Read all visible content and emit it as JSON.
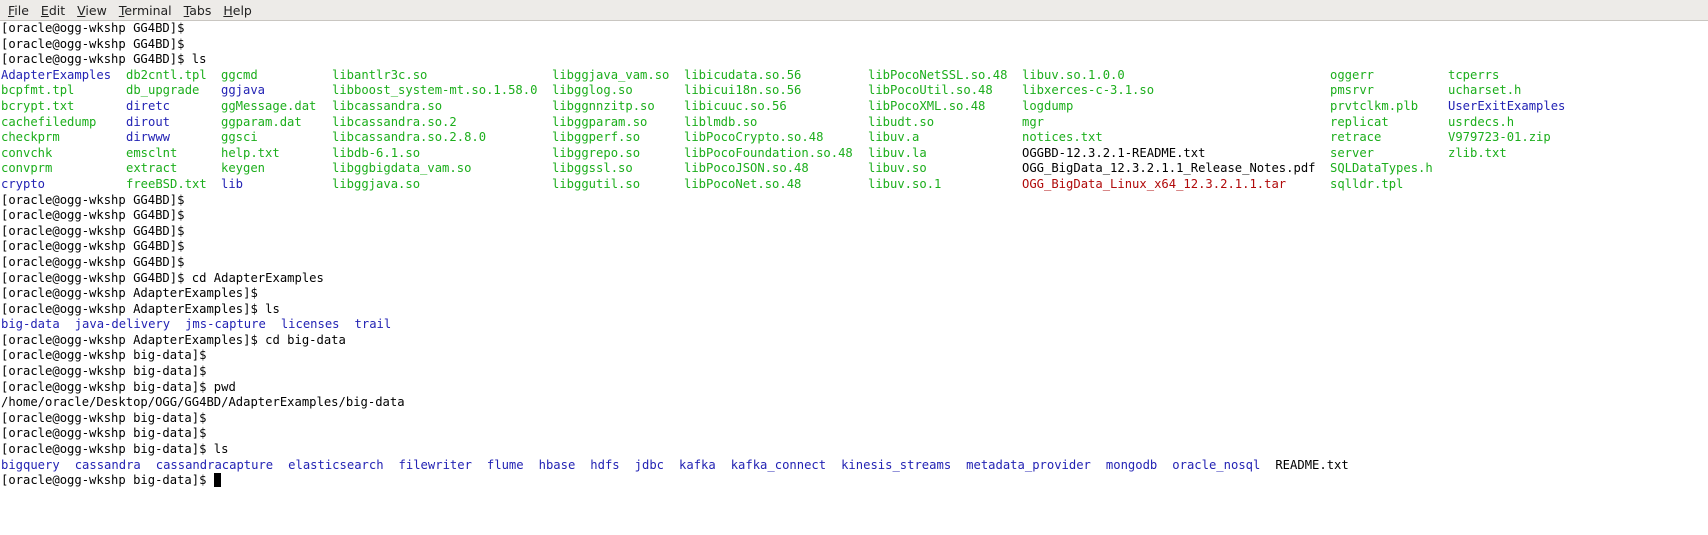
{
  "menu": [
    "File",
    "Edit",
    "View",
    "Terminal",
    "Tabs",
    "Help"
  ],
  "menu_mnemonic_index": [
    0,
    0,
    0,
    0,
    2,
    0
  ],
  "colors": {
    "exec": "#1cae1c",
    "dir": "#2323b4",
    "archive": "#b00a0a",
    "plain": "#000000"
  },
  "lines": [
    {
      "type": "text",
      "text": "[oracle@ogg-wkshp GG4BD]$"
    },
    {
      "type": "text",
      "text": "[oracle@ogg-wkshp GG4BD]$"
    },
    {
      "type": "text",
      "text": "[oracle@ogg-wkshp GG4BD]$ ls"
    },
    {
      "type": "grid",
      "cells": [
        [
          "AdapterExamples",
          "blue"
        ],
        [
          "db2cntl.tpl",
          "green"
        ],
        [
          "ggcmd",
          "green"
        ],
        [
          "libantlr3c.so",
          "green"
        ],
        [
          "libggjava_vam.so",
          "green"
        ],
        [
          "libicudata.so.56",
          "green"
        ],
        [
          "libPocoNetSSL.so.48",
          "green"
        ],
        [
          "libuv.so.1.0.0",
          "green"
        ],
        [
          "oggerr",
          "green"
        ],
        [
          "tcperrs",
          "green"
        ]
      ]
    },
    {
      "type": "grid",
      "cells": [
        [
          "bcpfmt.tpl",
          "green"
        ],
        [
          "db_upgrade",
          "green"
        ],
        [
          "ggjava",
          "blue"
        ],
        [
          "libboost_system-mt.so.1.58.0",
          "green"
        ],
        [
          "libgglog.so",
          "green"
        ],
        [
          "libicui18n.so.56",
          "green"
        ],
        [
          "libPocoUtil.so.48",
          "green"
        ],
        [
          "libxerces-c-3.1.so",
          "green"
        ],
        [
          "pmsrvr",
          "green"
        ],
        [
          "ucharset.h",
          "green"
        ]
      ]
    },
    {
      "type": "grid",
      "cells": [
        [
          "bcrypt.txt",
          "green"
        ],
        [
          "diretc",
          "blue"
        ],
        [
          "ggMessage.dat",
          "green"
        ],
        [
          "libcassandra.so",
          "green"
        ],
        [
          "libggnnzitp.so",
          "green"
        ],
        [
          "libicuuc.so.56",
          "green"
        ],
        [
          "libPocoXML.so.48",
          "green"
        ],
        [
          "logdump",
          "green"
        ],
        [
          "prvtclkm.plb",
          "green"
        ],
        [
          "UserExitExamples",
          "blue"
        ]
      ]
    },
    {
      "type": "grid",
      "cells": [
        [
          "cachefiledump",
          "green"
        ],
        [
          "dirout",
          "blue"
        ],
        [
          "ggparam.dat",
          "green"
        ],
        [
          "libcassandra.so.2",
          "green"
        ],
        [
          "libggparam.so",
          "green"
        ],
        [
          "liblmdb.so",
          "green"
        ],
        [
          "libudt.so",
          "green"
        ],
        [
          "mgr",
          "green"
        ],
        [
          "replicat",
          "green"
        ],
        [
          "usrdecs.h",
          "green"
        ]
      ]
    },
    {
      "type": "grid",
      "cells": [
        [
          "checkprm",
          "green"
        ],
        [
          "dirwww",
          "blue"
        ],
        [
          "ggsci",
          "green"
        ],
        [
          "libcassandra.so.2.8.0",
          "green"
        ],
        [
          "libggperf.so",
          "green"
        ],
        [
          "libPocoCrypto.so.48",
          "green"
        ],
        [
          "libuv.a",
          "green"
        ],
        [
          "notices.txt",
          "green"
        ],
        [
          "retrace",
          "green"
        ],
        [
          "V979723-01.zip",
          "green"
        ]
      ]
    },
    {
      "type": "grid",
      "cells": [
        [
          "convchk",
          "green"
        ],
        [
          "emsclnt",
          "green"
        ],
        [
          "help.txt",
          "green"
        ],
        [
          "libdb-6.1.so",
          "green"
        ],
        [
          "libggrepo.so",
          "green"
        ],
        [
          "libPocoFoundation.so.48",
          "green"
        ],
        [
          "libuv.la",
          "green"
        ],
        [
          "OGGBD-12.3.2.1-README.txt",
          "black"
        ],
        [
          "server",
          "green"
        ],
        [
          "zlib.txt",
          "green"
        ]
      ]
    },
    {
      "type": "grid",
      "cells": [
        [
          "convprm",
          "green"
        ],
        [
          "extract",
          "green"
        ],
        [
          "keygen",
          "green"
        ],
        [
          "libggbigdata_vam.so",
          "green"
        ],
        [
          "libggssl.so",
          "green"
        ],
        [
          "libPocoJSON.so.48",
          "green"
        ],
        [
          "libuv.so",
          "green"
        ],
        [
          "OGG_BigData_12.3.2.1.1_Release_Notes.pdf",
          "black"
        ],
        [
          "SQLDataTypes.h",
          "green"
        ],
        [
          "",
          ""
        ]
      ]
    },
    {
      "type": "grid",
      "cells": [
        [
          "crypto",
          "blue"
        ],
        [
          "freeBSD.txt",
          "green"
        ],
        [
          "lib",
          "blue"
        ],
        [
          "libggjava.so",
          "green"
        ],
        [
          "libggutil.so",
          "green"
        ],
        [
          "libPocoNet.so.48",
          "green"
        ],
        [
          "libuv.so.1",
          "green"
        ],
        [
          "OGG_BigData_Linux_x64_12.3.2.1.1.tar",
          "red"
        ],
        [
          "sqlldr.tpl",
          "green"
        ],
        [
          "",
          ""
        ]
      ]
    },
    {
      "type": "text",
      "text": "[oracle@ogg-wkshp GG4BD]$"
    },
    {
      "type": "text",
      "text": "[oracle@ogg-wkshp GG4BD]$"
    },
    {
      "type": "text",
      "text": "[oracle@ogg-wkshp GG4BD]$"
    },
    {
      "type": "text",
      "text": "[oracle@ogg-wkshp GG4BD]$"
    },
    {
      "type": "text",
      "text": "[oracle@ogg-wkshp GG4BD]$"
    },
    {
      "type": "text",
      "text": "[oracle@ogg-wkshp GG4BD]$ cd AdapterExamples"
    },
    {
      "type": "text",
      "text": "[oracle@ogg-wkshp AdapterExamples]$"
    },
    {
      "type": "text",
      "text": "[oracle@ogg-wkshp AdapterExamples]$ ls"
    },
    {
      "type": "inline",
      "cells": [
        [
          "big-data",
          "blue"
        ],
        [
          "java-delivery",
          "blue"
        ],
        [
          "jms-capture",
          "blue"
        ],
        [
          "licenses",
          "blue"
        ],
        [
          "trail",
          "blue"
        ]
      ]
    },
    {
      "type": "text",
      "text": "[oracle@ogg-wkshp AdapterExamples]$ cd big-data"
    },
    {
      "type": "text",
      "text": "[oracle@ogg-wkshp big-data]$"
    },
    {
      "type": "text",
      "text": "[oracle@ogg-wkshp big-data]$"
    },
    {
      "type": "text",
      "text": "[oracle@ogg-wkshp big-data]$ pwd"
    },
    {
      "type": "text",
      "text": "/home/oracle/Desktop/OGG/GG4BD/AdapterExamples/big-data"
    },
    {
      "type": "text",
      "text": "[oracle@ogg-wkshp big-data]$"
    },
    {
      "type": "text",
      "text": "[oracle@ogg-wkshp big-data]$"
    },
    {
      "type": "text",
      "text": "[oracle@ogg-wkshp big-data]$ ls"
    },
    {
      "type": "inline",
      "cells": [
        [
          "bigquery",
          "blue"
        ],
        [
          "cassandra",
          "blue"
        ],
        [
          "cassandracapture",
          "blue"
        ],
        [
          "elasticsearch",
          "blue"
        ],
        [
          "filewriter",
          "blue"
        ],
        [
          "flume",
          "blue"
        ],
        [
          "hbase",
          "blue"
        ],
        [
          "hdfs",
          "blue"
        ],
        [
          "jdbc",
          "blue"
        ],
        [
          "kafka",
          "blue"
        ],
        [
          "kafka_connect",
          "blue"
        ],
        [
          "kinesis_streams",
          "blue"
        ],
        [
          "metadata_provider",
          "blue"
        ],
        [
          "mongodb",
          "blue"
        ],
        [
          "oracle_nosql",
          "blue"
        ],
        [
          "README.txt",
          "black"
        ]
      ]
    },
    {
      "type": "prompt",
      "text": "[oracle@ogg-wkshp big-data]$ "
    }
  ]
}
